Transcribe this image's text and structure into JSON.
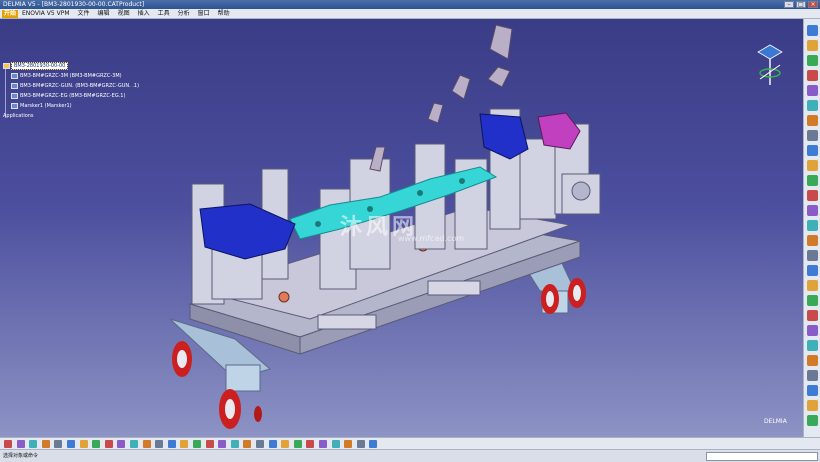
{
  "titlebar": {
    "title": "DELMIA V5 - [BM3-2801930-00-00.CATProduct]"
  },
  "menubar": {
    "logo": "开始",
    "items": [
      "ENOVIA V5 VPM",
      "文件",
      "编辑",
      "视图",
      "插入",
      "工具",
      "分析",
      "窗口",
      "帮助"
    ]
  },
  "tree": {
    "root": "BM3-2801930-00-00",
    "children": [
      "BM3-BM#GRZC-3M (BM3-BM#GRZC-3M)",
      "BM3-BM#GRZC-GUN. (BM3-BM#GRZC-GUN. .1)",
      "BM3-BM#GRZC-EG (BM3-BM#GRZC-EG.1)",
      "Marsker1 (Marsker1)"
    ],
    "applications": "Applications"
  },
  "watermark": {
    "main": "沐风网",
    "sub": "www.mfcad.com"
  },
  "brand_corner": "DELMIA",
  "statusbar": {
    "text": "选择对象或命令"
  },
  "colors": {
    "bg_top": "#3a3c86",
    "bg_bottom": "#8d93c4",
    "fixture_plate": "#c8c8da",
    "blue_part": "#2030c8",
    "cyan_part": "#36d6d6",
    "magenta_part": "#c040c0",
    "wheel": "#d02020"
  },
  "icons": {
    "right_toolbar": [
      "select-icon",
      "sketch-icon",
      "measure-icon",
      "sphere-icon",
      "surface-icon",
      "assembly-icon",
      "constraint-icon",
      "snap-icon",
      "part-icon",
      "robot-icon",
      "weld-icon",
      "clash-icon",
      "section-icon",
      "plane-icon",
      "axis-icon",
      "point-icon",
      "curve-icon",
      "extrude-icon",
      "revolve-icon",
      "sweep-icon",
      "hole-icon",
      "chamfer-icon",
      "fillet-icon",
      "draft-icon",
      "shell-icon",
      "pattern-icon",
      "mirror-icon"
    ],
    "bottom_toolbar": [
      "new-icon",
      "open-icon",
      "save-icon",
      "print-icon",
      "cut-icon",
      "copy-icon",
      "paste-icon",
      "undo-icon",
      "redo-icon",
      "help-icon",
      "formula-icon",
      "catalog-icon",
      "tree-icon",
      "fly-icon",
      "pan-icon",
      "rotate-icon",
      "zoom-in-icon",
      "zoom-out-icon",
      "normal-view-icon",
      "iso-view-icon",
      "shading-icon",
      "hide-icon",
      "swap-icon",
      "layer-icon",
      "material-icon",
      "render-icon",
      "compass-icon",
      "measure-icon",
      "analysis-icon",
      "snapshot-icon"
    ]
  }
}
